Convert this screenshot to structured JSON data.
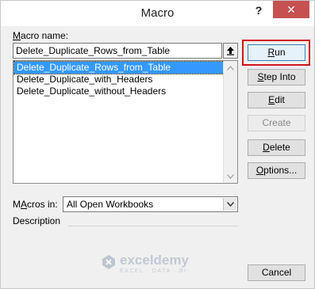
{
  "window": {
    "title": "Macro",
    "help_label": "?",
    "close_label": "✕"
  },
  "macro_name": {
    "label_prefix": "",
    "label_underline": "M",
    "label_rest": "acro name:",
    "value": "Delete_Duplicate_Rows_from_Table"
  },
  "macro_list": {
    "items": [
      "Delete_Duplicate_Rows_from_Table",
      "Delete_Duplicate_with_Headers",
      "Delete_Duplicate_without_Headers"
    ],
    "selected_index": 0
  },
  "macros_in": {
    "label_underline": "A",
    "label_pre": "M",
    "label_rest": "cros in:",
    "value": "All Open Workbooks"
  },
  "description": {
    "label": "Description"
  },
  "buttons": {
    "run": {
      "pre": "",
      "u": "R",
      "post": "un"
    },
    "step_into": {
      "pre": "",
      "u": "S",
      "post": "tep Into"
    },
    "edit": {
      "pre": "",
      "u": "E",
      "post": "dit"
    },
    "create": {
      "pre": "",
      "u": "",
      "post": "Create"
    },
    "delete": {
      "pre": "",
      "u": "D",
      "post": "elete"
    },
    "options": {
      "pre": "",
      "u": "O",
      "post": "ptions..."
    },
    "cancel": {
      "pre": "",
      "u": "",
      "post": "Cancel"
    }
  },
  "watermark": {
    "name": "exceldemy",
    "tagline": "EXCEL · DATA · BI"
  },
  "colors": {
    "selection": "#3399ff",
    "close": "#c75050",
    "highlight": "#d0141e"
  }
}
